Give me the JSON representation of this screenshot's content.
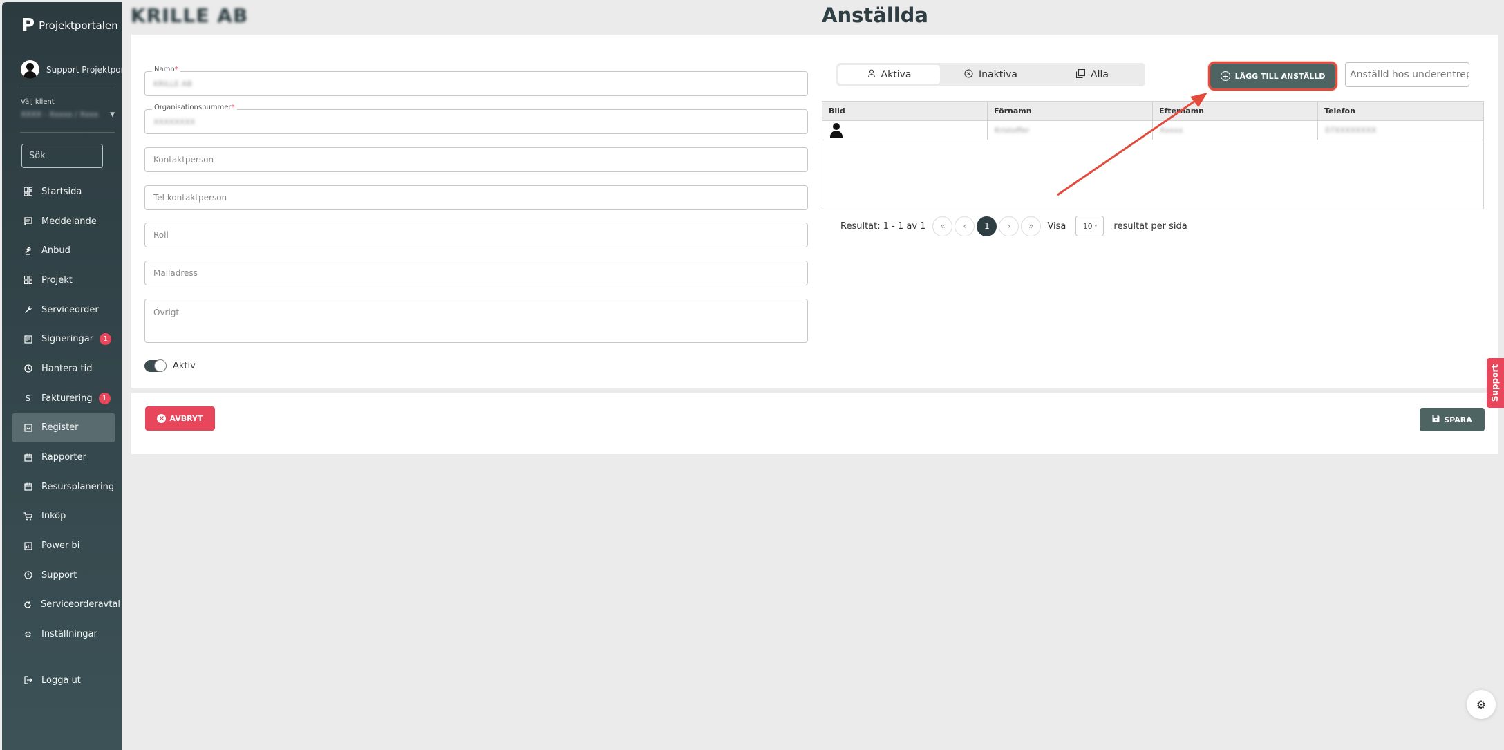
{
  "sidebar": {
    "brand": "Projektportalen",
    "user_name": "Support Projektportalen",
    "client_label": "Välj klient",
    "client_value": "XXXX - Xxxxx / Xxxx",
    "search_placeholder": "Sök",
    "items": [
      {
        "label": "Startsida",
        "icon": "dashboard-icon"
      },
      {
        "label": "Meddelande",
        "icon": "message-icon"
      },
      {
        "label": "Anbud",
        "icon": "gavel-icon"
      },
      {
        "label": "Projekt",
        "icon": "grid-icon"
      },
      {
        "label": "Serviceorder",
        "icon": "wrench-icon"
      },
      {
        "label": "Signeringar",
        "icon": "signature-icon",
        "badge": "1"
      },
      {
        "label": "Hantera tid",
        "icon": "clock-icon"
      },
      {
        "label": "Fakturering",
        "icon": "dollar-icon",
        "badge": "1"
      },
      {
        "label": "Register",
        "icon": "register-icon"
      },
      {
        "label": "Rapporter",
        "icon": "calendar-icon"
      },
      {
        "label": "Resursplanering",
        "icon": "calendar-icon"
      },
      {
        "label": "Inköp",
        "icon": "cart-icon"
      },
      {
        "label": "Power bi",
        "icon": "chart-icon"
      },
      {
        "label": "Support",
        "icon": "help-icon"
      },
      {
        "label": "Serviceorderavtal",
        "icon": "cycle-icon"
      },
      {
        "label": "Inställningar",
        "icon": "gear-icon"
      }
    ],
    "logout": "Logga ut"
  },
  "header": {
    "company": "KRILLE AB",
    "title": "Anställda"
  },
  "form": {
    "name_label": "Namn",
    "name_value": "KRILLE AB",
    "org_label": "Organisationsnummer",
    "org_value": "XXXXXXXX",
    "contact_placeholder": "Kontaktperson",
    "phone_placeholder": "Tel kontaktperson",
    "role_placeholder": "Roll",
    "mail_placeholder": "Mailadress",
    "other_placeholder": "Övrigt",
    "active_label": "Aktiv",
    "required_mark": "*"
  },
  "tabs": [
    {
      "label": "Aktiva"
    },
    {
      "label": "Inaktiva"
    },
    {
      "label": "Alla"
    }
  ],
  "add_button": "LÄGG TILL ANSTÄLLD",
  "sub_search_placeholder": "Anställd hos underentreprenör",
  "table": {
    "headers": [
      "Bild",
      "Förnamn",
      "Efternamn",
      "Telefon"
    ],
    "rows": [
      {
        "first": "Kristoffer",
        "last": "Xxxxx",
        "phone": "07XXXXXXXX"
      }
    ]
  },
  "pagination": {
    "result": "Resultat: 1 - 1 av 1",
    "first": "«",
    "prev": "‹",
    "current": "1",
    "next": "›",
    "last": "»",
    "show": "Visa",
    "per_page": "10",
    "per_page_suffix": "resultat per sida"
  },
  "footer": {
    "cancel": "AVBRYT",
    "save": "SPARA"
  },
  "support_tab": "Support",
  "colors": {
    "accent": "#4d6463",
    "danger": "#e8475b",
    "sidebar": "#2c3b40",
    "annotation": "#e34b3d"
  }
}
